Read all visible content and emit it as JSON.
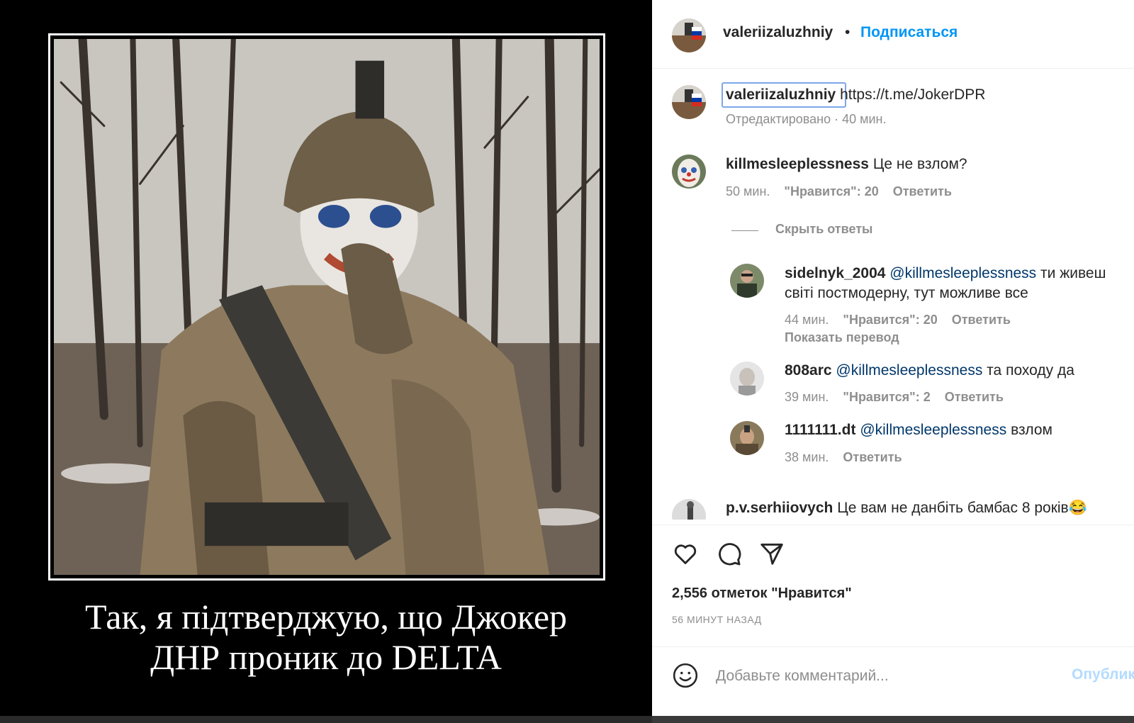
{
  "post": {
    "image_caption_lines": [
      "Так, я підтверджую, що Джокер",
      "ДНР проник до DELTA"
    ]
  },
  "header": {
    "username": "valeriizaluzhniy",
    "separator": "•",
    "follow_label": "Подписаться"
  },
  "caption": {
    "username": "valeriizaluzhniy",
    "text": "https://t.me/JokerDPR",
    "edited_label": "Отредактировано",
    "time": "40 мин."
  },
  "comments": [
    {
      "username": "killmesleeplessness",
      "text": "Це не взлом?",
      "time": "50 мин.",
      "likes": "\"Нравится\": 20",
      "reply_label": "Ответить"
    }
  ],
  "hide_replies_label": "Скрыть ответы",
  "replies": [
    {
      "username": "sidelnyk_2004",
      "mention": "@killmesleeplessness",
      "text_line1": "ти живеш",
      "text_line2": "світі постмодерну, тут можливе все",
      "time": "44 мин.",
      "likes": "\"Нравится\": 20",
      "reply_label": "Ответить",
      "translate_label": "Показать перевод"
    },
    {
      "username": "808arc",
      "mention": "@killmesleeplessness",
      "text": "та походу да",
      "time": "39 мин.",
      "likes": "\"Нравится\": 2",
      "reply_label": "Ответить"
    },
    {
      "username": "1111111.dt",
      "mention": "@killmesleeplessness",
      "text": "взлом",
      "time": "38 мин.",
      "reply_label": "Ответить"
    }
  ],
  "last_comment": {
    "username": "p.v.serhiiovych",
    "text": "Це вам не данбіть бамбас 8 років",
    "emoji": "😂"
  },
  "actions": {
    "like_icon": "heart-icon",
    "comment_icon": "comment-icon",
    "share_icon": "paper-plane-icon"
  },
  "likes_count": "2,556 отметок \"Нравится\"",
  "time_ago": "56 МИНУТ НАЗАД",
  "composer": {
    "placeholder": "Добавьте комментарий...",
    "publish_label": "Опубликовать",
    "emoji_icon": "smiley-icon"
  },
  "colors": {
    "accent": "#0095f6",
    "mention": "#00376b",
    "muted": "#8e8e8e",
    "publish_disabled": "#b3dbff"
  }
}
